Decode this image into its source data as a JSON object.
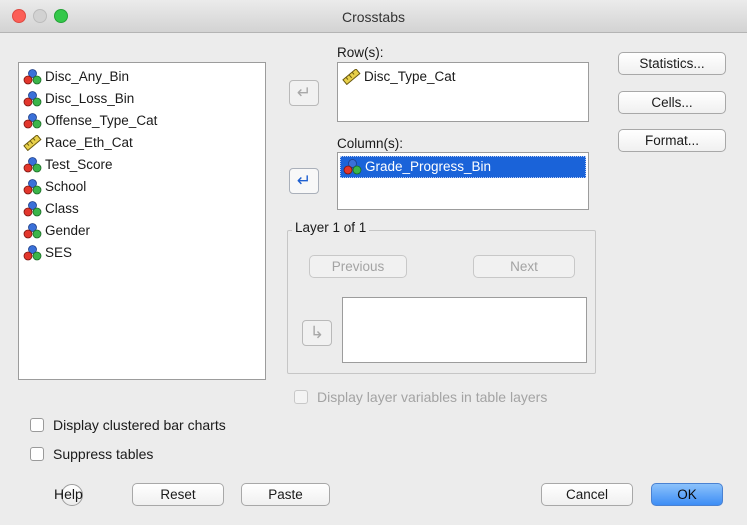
{
  "window": {
    "title": "Crosstabs"
  },
  "source_variables": [
    {
      "name": "Disc_Any_Bin",
      "icon": "nominal-icon"
    },
    {
      "name": "Disc_Loss_Bin",
      "icon": "nominal-icon"
    },
    {
      "name": "Offense_Type_Cat",
      "icon": "nominal-icon"
    },
    {
      "name": "Race_Eth_Cat",
      "icon": "scale-icon"
    },
    {
      "name": "Test_Score",
      "icon": "nominal-icon"
    },
    {
      "name": "School",
      "icon": "nominal-icon"
    },
    {
      "name": "Class",
      "icon": "nominal-icon"
    },
    {
      "name": "Gender",
      "icon": "nominal-icon"
    },
    {
      "name": "SES",
      "icon": "nominal-icon"
    }
  ],
  "rows": {
    "label": "Row(s):",
    "items": [
      {
        "name": "Disc_Type_Cat",
        "icon": "scale-icon"
      }
    ]
  },
  "columns": {
    "label": "Column(s):",
    "items": [
      {
        "name": "Grade_Progress_Bin",
        "icon": "nominal-icon",
        "selected": true
      }
    ]
  },
  "layer": {
    "title": "Layer 1 of 1",
    "previous_label": "Previous",
    "next_label": "Next"
  },
  "side_buttons": {
    "statistics": "Statistics...",
    "cells": "Cells...",
    "format": "Format..."
  },
  "options": {
    "display_layer_vars": "Display layer variables in table layers",
    "clustered_bar": "Display clustered bar charts",
    "suppress_tables": "Suppress tables"
  },
  "footer": {
    "help": "Help",
    "reset": "Reset",
    "paste": "Paste",
    "cancel": "Cancel",
    "ok": "OK"
  },
  "colors": {
    "accent": "#1a63d9",
    "ok_button": "#3d8df5",
    "nominal_red": "#e2362c",
    "nominal_blue": "#3a70d8",
    "nominal_green": "#3bb54a",
    "scale_yellow": "#e8d04a"
  }
}
